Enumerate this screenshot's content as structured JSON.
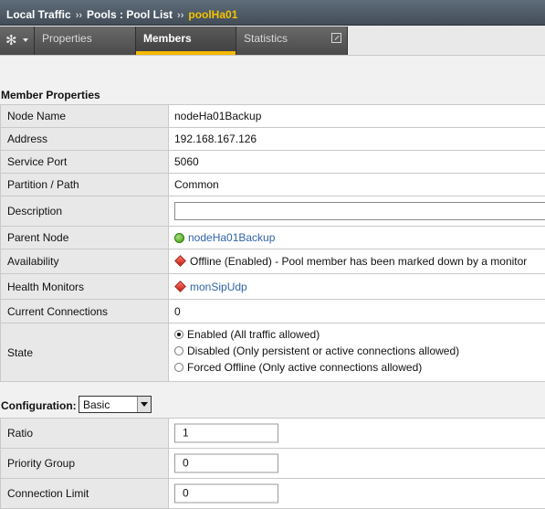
{
  "breadcrumb": {
    "items": [
      "Local Traffic",
      "Pools : Pool List"
    ],
    "separator": "››",
    "current": "poolHa01"
  },
  "tabs": {
    "properties": "Properties",
    "members": "Members",
    "statistics": "Statistics"
  },
  "member_properties": {
    "title": "Member Properties",
    "rows": {
      "node_name": {
        "label": "Node Name",
        "value": "nodeHa01Backup"
      },
      "address": {
        "label": "Address",
        "value": "192.168.167.126"
      },
      "service_port": {
        "label": "Service Port",
        "value": "5060"
      },
      "partition": {
        "label": "Partition / Path",
        "value": "Common"
      },
      "description": {
        "label": "Description",
        "value": ""
      },
      "parent_node": {
        "label": "Parent Node",
        "value": "nodeHa01Backup"
      },
      "availability": {
        "label": "Availability",
        "value": "Offline (Enabled) - Pool member has been marked down by a monitor"
      },
      "health_monitors": {
        "label": "Health Monitors",
        "value": "monSipUdp"
      },
      "current_connections": {
        "label": "Current Connections",
        "value": "0"
      },
      "state": {
        "label": "State",
        "options": [
          "Enabled (All traffic allowed)",
          "Disabled (Only persistent or active connections allowed)",
          "Forced Offline (Only active connections allowed)"
        ],
        "selected": 0
      }
    }
  },
  "configuration": {
    "label": "Configuration:",
    "selected": "Basic",
    "rows": {
      "ratio": {
        "label": "Ratio",
        "value": "1"
      },
      "priority_group": {
        "label": "Priority Group",
        "value": "0"
      },
      "connection_limit": {
        "label": "Connection Limit",
        "value": "0"
      }
    }
  },
  "colors": {
    "breadcrumb_current": "#f5c300",
    "active_tab_underline": "#f5b800",
    "link": "#3064a8",
    "status_offline": "#c21c10",
    "status_node_up": "#3d9a12"
  }
}
